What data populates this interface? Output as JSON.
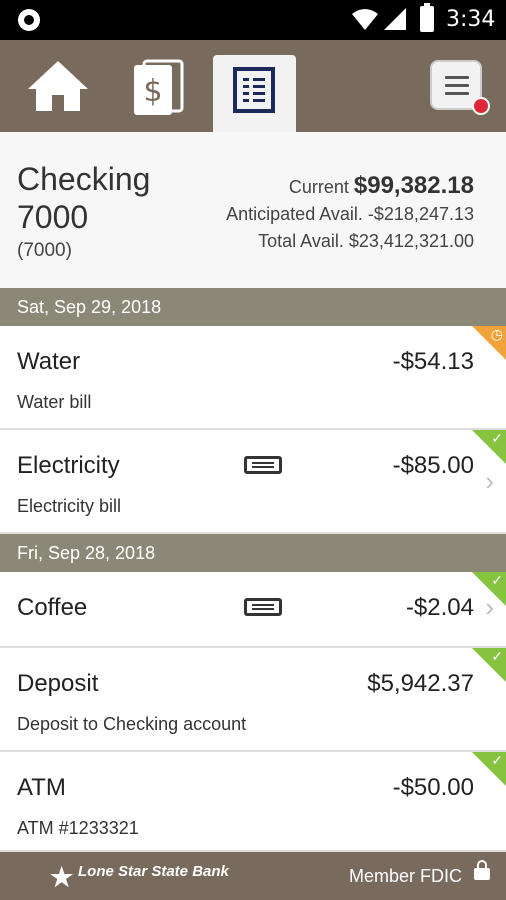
{
  "status_bar": {
    "time": "3:34"
  },
  "nav": {
    "tabs": [
      {
        "icon": "home-icon"
      },
      {
        "icon": "dollar-icon"
      },
      {
        "icon": "document-list-icon",
        "active": true
      }
    ],
    "menu_icon": "menu-icon"
  },
  "account": {
    "name": "Checking 7000",
    "number": "(7000)",
    "current_label": "Current",
    "current_amount": "$99,382.18",
    "anticipated": "Anticipated Avail. -$218,247.13",
    "total": "Total Avail. $23,412,321.00"
  },
  "groups": [
    {
      "date": "Sat, Sep 29, 2018",
      "transactions": [
        {
          "title": "Water",
          "description": "Water bill",
          "amount": "-$54.13",
          "status": "pending"
        },
        {
          "title": "Electricity",
          "description": "Electricity bill",
          "amount": "-$85.00",
          "status": "cleared",
          "card": true
        }
      ]
    },
    {
      "date": "Fri, Sep 28, 2018",
      "transactions": [
        {
          "title": "Coffee",
          "description": "",
          "amount": "-$2.04",
          "status": "cleared",
          "card": true
        },
        {
          "title": "Deposit",
          "description": "Deposit to Checking account",
          "amount": "$5,942.37",
          "status": "cleared"
        },
        {
          "title": "ATM",
          "description": "ATM #1233321",
          "amount": "-$50.00",
          "status": "cleared"
        }
      ]
    }
  ],
  "footer": {
    "logo_text": "Lone Star State Bank",
    "fdic": "Member FDIC"
  },
  "colors": {
    "brand": "#786a5c",
    "date_header": "#8c8878",
    "cleared": "#86c440",
    "pending": "#f1a23a"
  }
}
